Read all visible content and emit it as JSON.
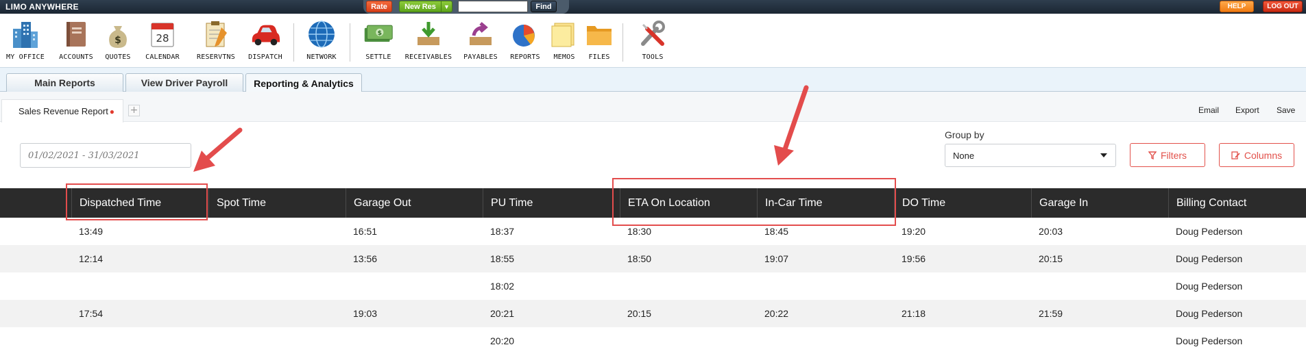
{
  "topbar": {
    "brand": "LIMO ANYWHERE",
    "rate_label": "Rate",
    "newres_label": "New Res",
    "search_value": "",
    "find_label": "Find",
    "help_label": "HELP",
    "logout_label": "LOG OUT"
  },
  "toolbar": {
    "items": [
      {
        "label": "MY OFFICE",
        "icon": "office-building-icon"
      },
      {
        "label": "ACCOUNTS",
        "icon": "address-book-icon"
      },
      {
        "label": "QUOTES",
        "icon": "money-bag-icon"
      },
      {
        "label": "CALENDAR",
        "icon": "calendar-icon"
      },
      {
        "label": "RESERVTNS",
        "icon": "clipboard-pencil-icon"
      },
      {
        "label": "DISPATCH",
        "icon": "car-icon"
      },
      {
        "label": "NETWORK",
        "icon": "globe-icon"
      },
      {
        "label": "SETTLE",
        "icon": "cash-icon"
      },
      {
        "label": "RECEIVABLES",
        "icon": "inbox-arrow-icon"
      },
      {
        "label": "PAYABLES",
        "icon": "outbox-arrow-icon"
      },
      {
        "label": "REPORTS",
        "icon": "pie-chart-icon"
      },
      {
        "label": "MEMOS",
        "icon": "sticky-note-icon"
      },
      {
        "label": "FILES",
        "icon": "folder-icon"
      },
      {
        "label": "TOOLS",
        "icon": "wrench-screwdriver-icon"
      }
    ],
    "calendar_day": "28"
  },
  "tabs": [
    {
      "label": "Main Reports"
    },
    {
      "label": "View Driver Payroll"
    },
    {
      "label": "Reporting & Analytics"
    }
  ],
  "report_tab": {
    "label": "Sales Revenue Report",
    "add": "+"
  },
  "actions": {
    "email": "Email",
    "export": "Export",
    "save": "Save"
  },
  "filters": {
    "date_range": "01/02/2021 - 31/03/2021",
    "group_by_label": "Group by",
    "group_by_value": "None",
    "filters_label": "Filters",
    "columns_label": "Columns"
  },
  "table": {
    "columns": [
      "Dispatched Time",
      "Spot Time",
      "Garage Out",
      "PU Time",
      "ETA On Location",
      "In-Car Time",
      "DO Time",
      "Garage In",
      "Billing Contact"
    ],
    "rows": [
      [
        "13:49",
        "",
        "16:51",
        "18:37",
        "18:30",
        "18:45",
        "19:20",
        "20:03",
        "Doug Pederson"
      ],
      [
        "12:14",
        "",
        "13:56",
        "18:55",
        "18:50",
        "19:07",
        "19:56",
        "20:15",
        "Doug Pederson"
      ],
      [
        "",
        "",
        "",
        "18:02",
        "",
        "",
        "",
        "",
        "Doug Pederson"
      ],
      [
        "17:54",
        "",
        "19:03",
        "20:21",
        "20:15",
        "20:22",
        "21:18",
        "21:59",
        "Doug Pederson"
      ],
      [
        "",
        "",
        "",
        "20:20",
        "",
        "",
        "",
        "",
        "Doug Pederson"
      ]
    ]
  },
  "colors": {
    "accent": "#e2504a",
    "annotation": "#e34c4c",
    "header_bg": "#2b2b2b"
  }
}
